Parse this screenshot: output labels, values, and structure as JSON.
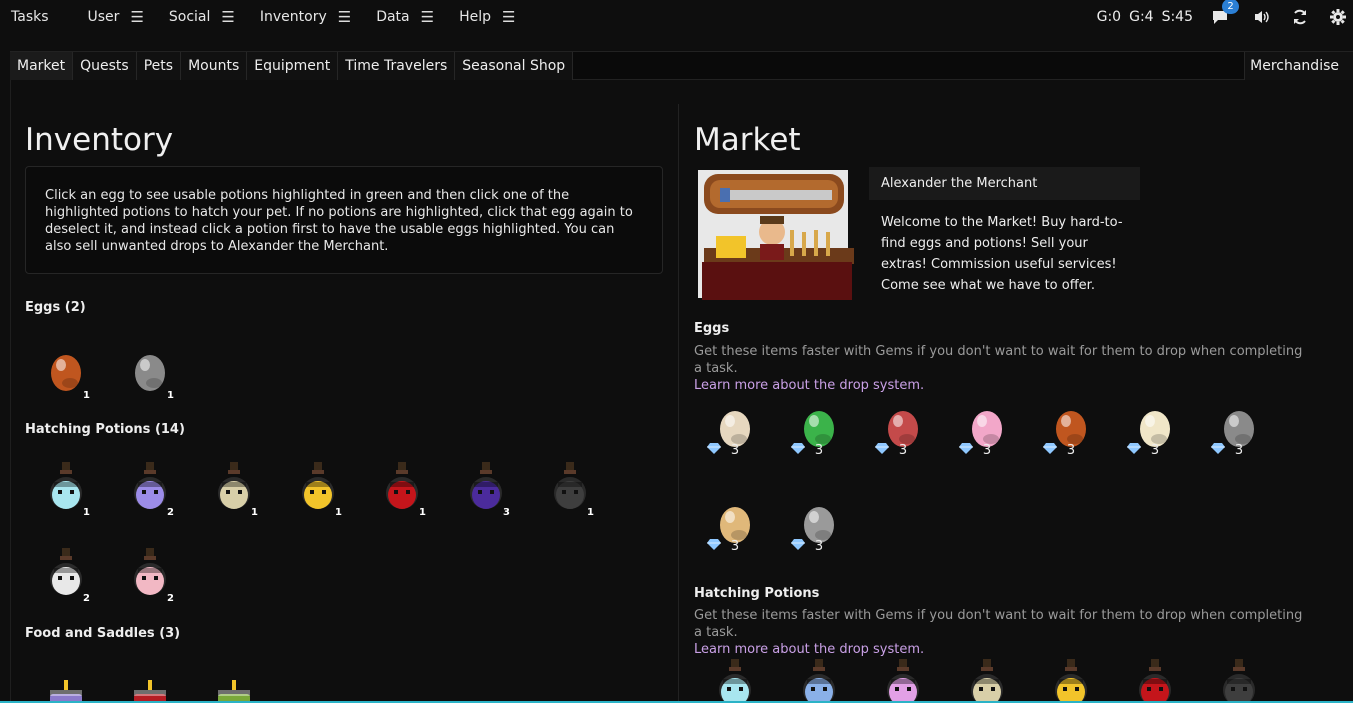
{
  "topnav": {
    "items": [
      {
        "label": "Tasks"
      },
      {
        "label": "User"
      },
      {
        "label": "Social"
      },
      {
        "label": "Inventory"
      },
      {
        "label": "Data"
      },
      {
        "label": "Help"
      }
    ],
    "menu_glyph": "☰"
  },
  "stats": {
    "gold": "G:0",
    "gems": "G:4",
    "silver": "S:45"
  },
  "notifications": {
    "count": "2"
  },
  "icons": [
    "chat-icon",
    "sound-icon",
    "sync-icon",
    "settings-icon"
  ],
  "tabs": [
    "Market",
    "Quests",
    "Pets",
    "Mounts",
    "Equipment",
    "Time Travelers",
    "Seasonal Shop"
  ],
  "tab_right": "Merchandise",
  "inventory": {
    "title": "Inventory",
    "info": "Click an egg to see usable potions highlighted in green and then click one of the highlighted potions to hatch your pet. If no potions are highlighted, click that egg again to deselect it, and instead click a potion first to have the usable eggs highlighted. You can also sell unwanted drops to Alexander the Merchant.",
    "eggs_title": "Eggs (2)",
    "eggs": [
      {
        "name": "fox-egg",
        "qty": "1",
        "color": "#c0561f"
      },
      {
        "name": "panda-egg",
        "qty": "1",
        "color": "#8a8a8a"
      }
    ],
    "potions_title": "Hatching Potions (14)",
    "potions": [
      {
        "name": "skeleton-potion",
        "qty": "1",
        "color": "#a8e6ef"
      },
      {
        "name": "purple-potion",
        "qty": "2",
        "color": "#9c8ce8"
      },
      {
        "name": "desert-potion",
        "qty": "1",
        "color": "#d8cfa8"
      },
      {
        "name": "golden-potion",
        "qty": "1",
        "color": "#f2c42a"
      },
      {
        "name": "red-potion",
        "qty": "1",
        "color": "#c4151b"
      },
      {
        "name": "shadow-potion",
        "qty": "3",
        "color": "#4b2b9c"
      },
      {
        "name": "zombie-potion",
        "qty": "1",
        "color": "#3e3e3e"
      },
      {
        "name": "white-potion",
        "qty": "2",
        "color": "#e8e8e8"
      },
      {
        "name": "cotton-candy-pink-potion",
        "qty": "2",
        "color": "#f2b8c4"
      }
    ],
    "food_title": "Food and Saddles (3)",
    "food": [
      {
        "name": "cake-food",
        "color": "#8c7acb"
      },
      {
        "name": "red-cake-food",
        "color": "#b51d24"
      },
      {
        "name": "potatoe-food",
        "color": "#7aa83a"
      }
    ]
  },
  "market": {
    "title": "Market",
    "merchant_name": "Alexander the Merchant",
    "merchant_text": "Welcome to the Market! Buy hard-to-find eggs and potions! Sell your extras! Commission useful services! Come see what we have to offer.",
    "eggs_title": "Eggs",
    "note": "Get these items faster with Gems if you don't want to wait for them to drop when completing a task.",
    "link": "Learn more about the drop system.",
    "eggs": [
      {
        "name": "bunny-egg",
        "price": "3",
        "color": "#e6d7bf"
      },
      {
        "name": "cactus-egg",
        "price": "3",
        "color": "#3bb34a"
      },
      {
        "name": "dragon-egg",
        "price": "3",
        "color": "#c44a4a"
      },
      {
        "name": "flying-pig-egg",
        "price": "3",
        "color": "#f2a7c9"
      },
      {
        "name": "fox-egg",
        "price": "3",
        "color": "#c0561f"
      },
      {
        "name": "lion-cub-egg",
        "price": "3",
        "color": "#f0e6c8"
      },
      {
        "name": "panda-egg",
        "price": "3",
        "color": "#8a8a8a"
      },
      {
        "name": "tiger-cub-egg",
        "price": "3",
        "color": "#e0b87a"
      },
      {
        "name": "wolf-egg",
        "price": "3",
        "color": "#9a9a9a"
      }
    ],
    "potions_title": "Hatching Potions",
    "potions_note": "Get these items faster with Gems if you don't want to wait for them to drop when completing a task.",
    "potions_link": "Learn more about the drop system.",
    "potions": [
      {
        "name": "skeleton-potion",
        "color": "#a8e6ef"
      },
      {
        "name": "blue-potion",
        "color": "#8ab0e8"
      },
      {
        "name": "pink-potion",
        "color": "#e2a0e6"
      },
      {
        "name": "desert-potion",
        "color": "#d8cfa8"
      },
      {
        "name": "golden-potion",
        "color": "#f2c42a"
      },
      {
        "name": "red-potion",
        "color": "#c4151b"
      },
      {
        "name": "zombie-potion",
        "color": "#3e3e3e"
      }
    ]
  },
  "colors": {
    "accent": "#2b7fd4",
    "link": "#c9a0e6",
    "gem": "#8fc8ff"
  }
}
